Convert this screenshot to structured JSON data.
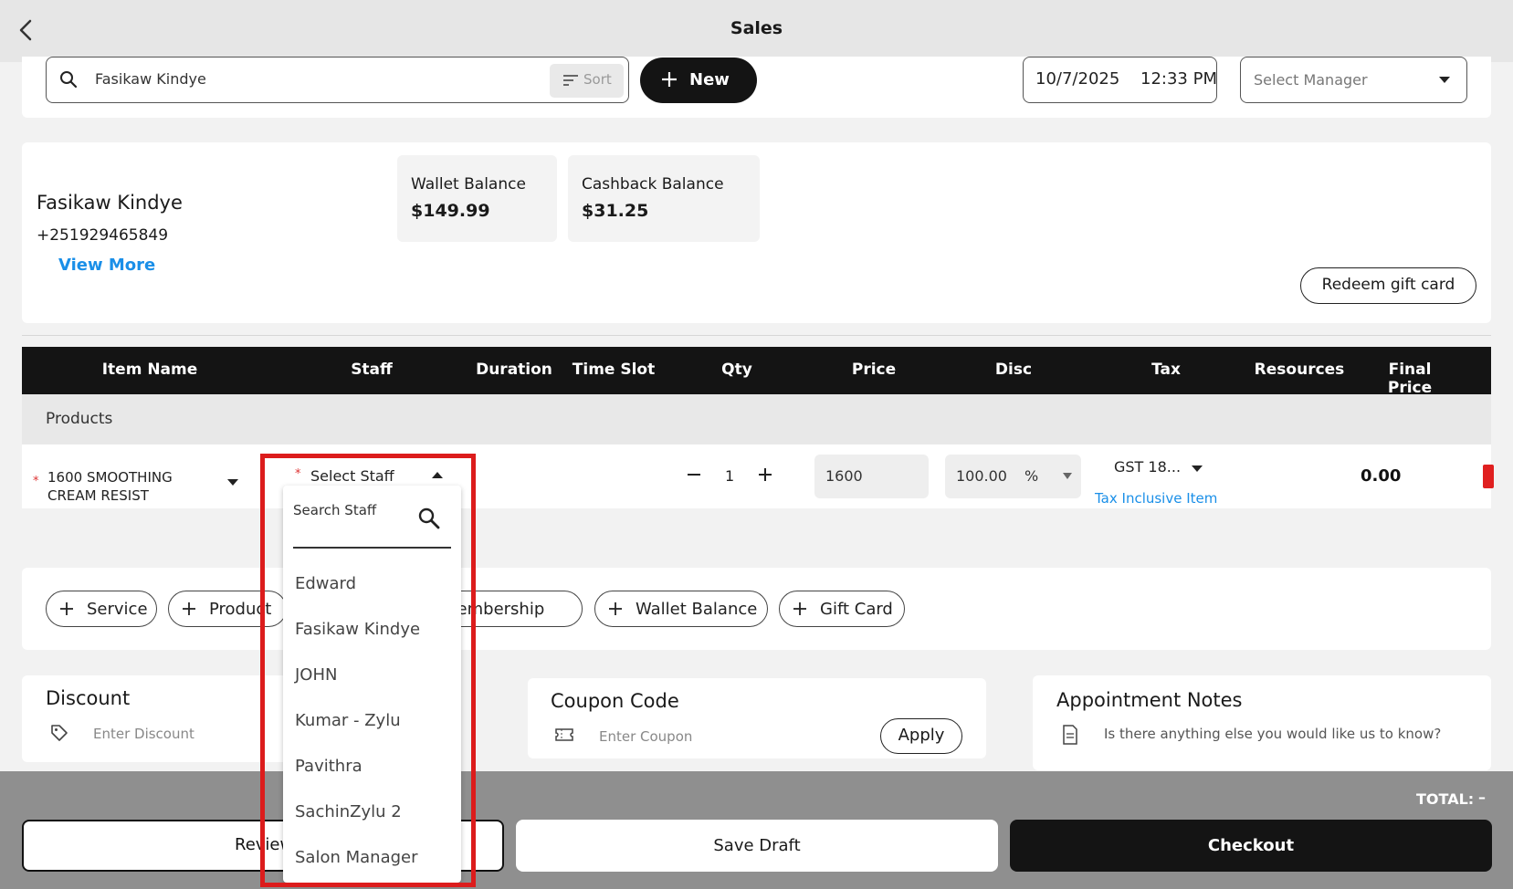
{
  "header": {
    "title": "Sales"
  },
  "search": {
    "value": "Fasikaw Kindye",
    "sort_label": "Sort"
  },
  "new_button": {
    "label": "New"
  },
  "datetime": {
    "date": "10/7/2025",
    "time": "12:33 PM"
  },
  "manager": {
    "placeholder": "Select Manager"
  },
  "customer": {
    "name": "Fasikaw Kindye",
    "phone": "+251929465849",
    "view_more": "View More",
    "wallet_label": "Wallet Balance",
    "wallet_value": "$149.99",
    "cashback_label": "Cashback Balance",
    "cashback_value": "$31.25",
    "redeem_label": "Redeem gift card"
  },
  "table": {
    "headers": [
      "Item Name",
      "Staff",
      "Duration",
      "Time Slot",
      "Qty",
      "Price",
      "Disc",
      "Tax",
      "Resources",
      "Final Price"
    ],
    "section": "Products",
    "row": {
      "item_line1": "1600 SMOOTHING",
      "item_line2": "CREAM RESIST",
      "staff_placeholder": "Select Staff",
      "qty": "1",
      "price": "1600",
      "disc_value": "100.00",
      "disc_unit": "%",
      "tax": "GST 18...",
      "tax_note": "Tax Inclusive Item",
      "final_price": "0.00"
    }
  },
  "add_chips": [
    {
      "label": "Service"
    },
    {
      "label": "Product"
    },
    {
      "label": "Membership"
    },
    {
      "label": "Wallet Balance"
    },
    {
      "label": "Gift Card"
    }
  ],
  "discount": {
    "title": "Discount",
    "placeholder": "Enter Discount"
  },
  "coupon": {
    "title": "Coupon Code",
    "placeholder": "Enter Coupon",
    "apply_label": "Apply"
  },
  "notes": {
    "title": "Appointment Notes",
    "placeholder": "Is there anything else you would like us to know?"
  },
  "footer": {
    "total_label": "TOTAL:",
    "total_value": "–",
    "review_label": "Review",
    "save_draft_label": "Save Draft",
    "checkout_label": "Checkout"
  },
  "staff_dropdown": {
    "search_placeholder": "Search Staff",
    "options": [
      "Edward",
      "Fasikaw Kindye",
      "JOHN",
      "Kumar - Zylu",
      "Pavithra",
      "SachinZylu 2",
      "Salon Manager"
    ]
  },
  "colors": {
    "accent_blue": "#1a8fe8",
    "highlight_red": "#dc1c1c",
    "dark": "#141414"
  }
}
